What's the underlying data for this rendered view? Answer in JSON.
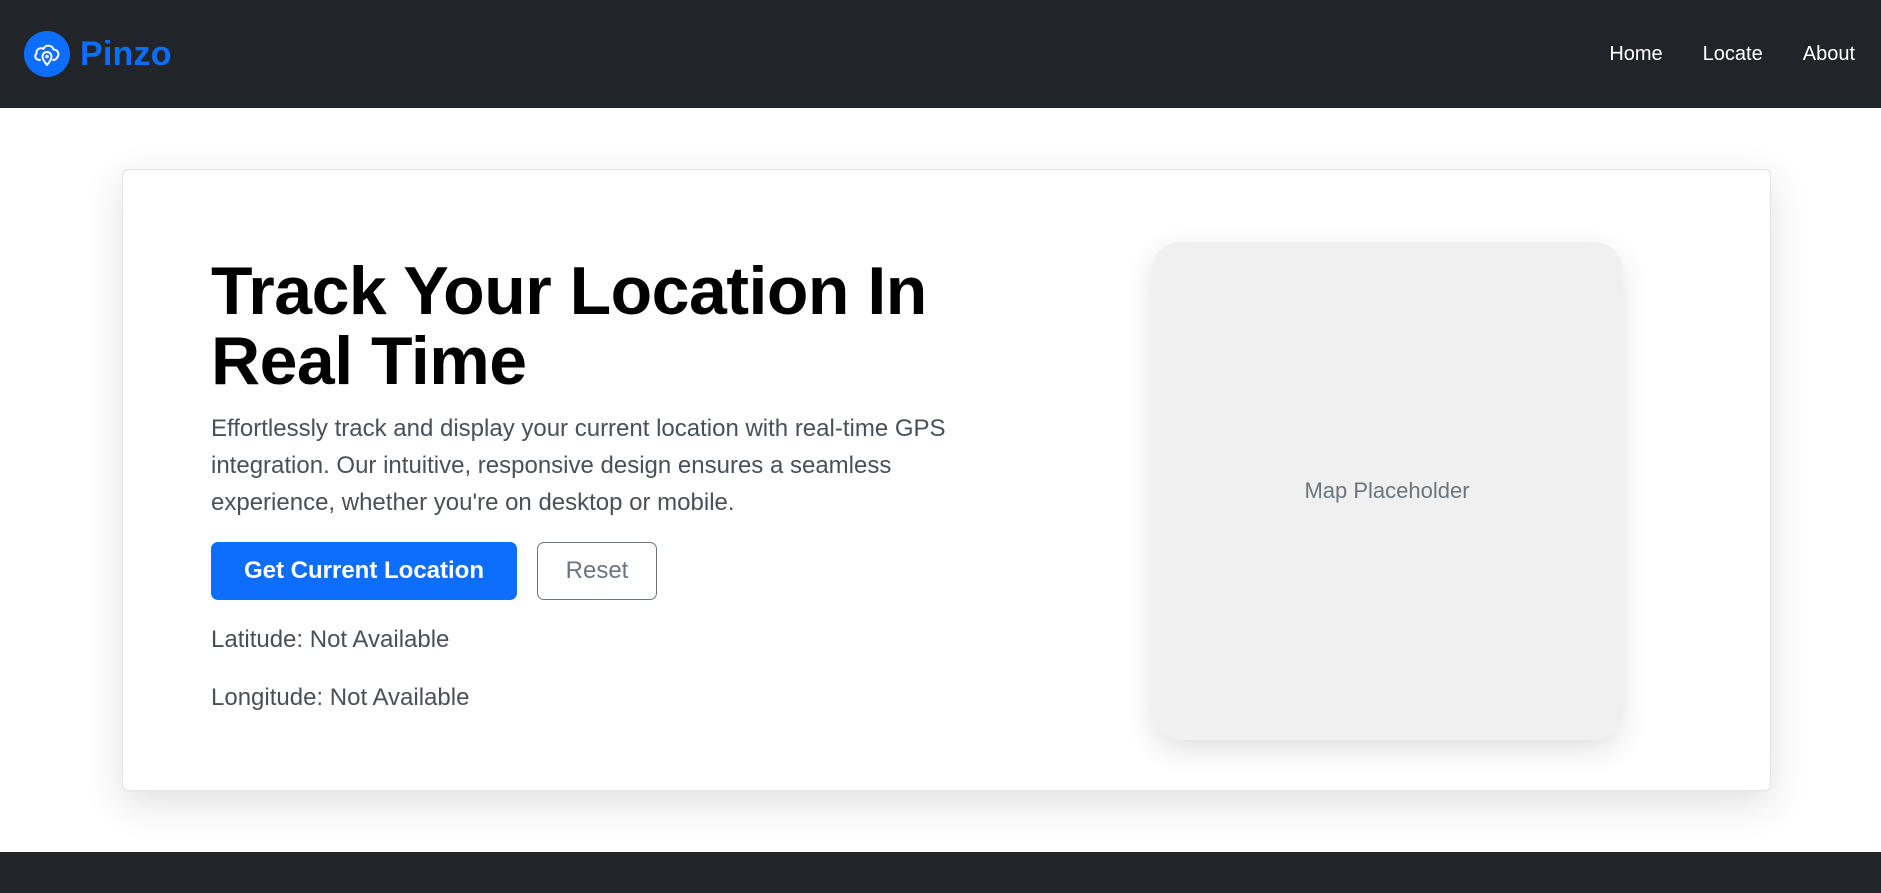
{
  "navbar": {
    "brand": "Pinzo",
    "brand_icon": "cloud-location-pin-icon",
    "links": [
      {
        "label": "Home"
      },
      {
        "label": "Locate"
      },
      {
        "label": "About"
      }
    ]
  },
  "hero": {
    "title": "Track Your Location In Real Time",
    "description": "Effortlessly track and display your current location with real-time GPS integration. Our intuitive, responsive design ensures a seamless experience, whether you're on desktop or mobile.",
    "primary_button": "Get Current Location",
    "secondary_button": "Reset",
    "latitude": "Latitude: Not Available",
    "longitude": "Longitude: Not Available"
  },
  "map": {
    "placeholder": "Map Placeholder"
  },
  "colors": {
    "navbar_bg": "#212529",
    "brand": "#0d6efd",
    "primary": "#0d6efd",
    "secondary": "#6c757d",
    "map_bg": "#f0f0f0"
  }
}
